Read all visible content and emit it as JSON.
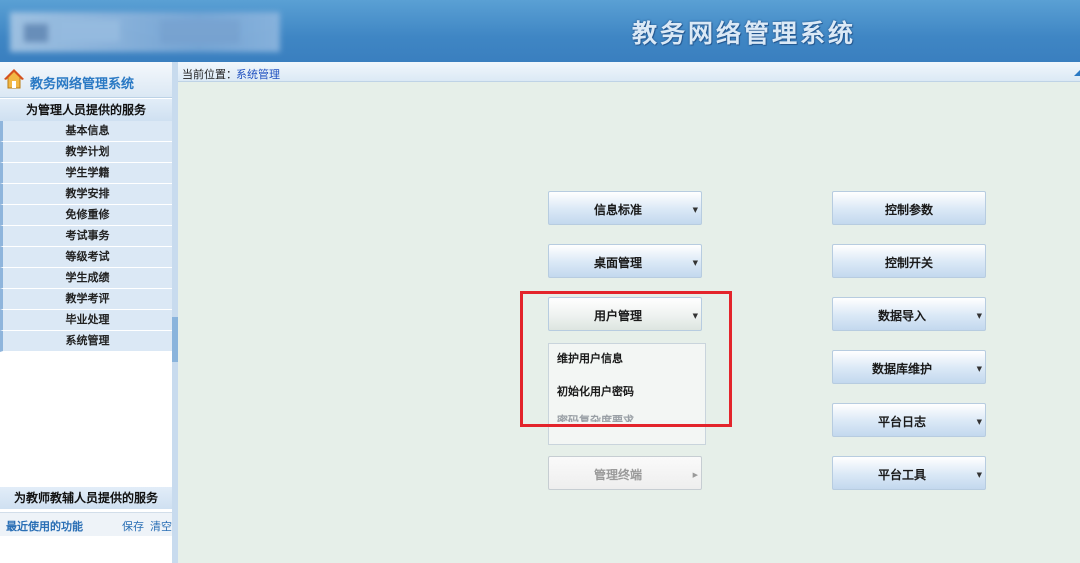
{
  "header": {
    "title": "教务网络管理系统"
  },
  "sidebar": {
    "brand": "教务网络管理系统",
    "admin_section": "为管理人员提供的服务",
    "items": [
      {
        "label": "基本信息"
      },
      {
        "label": "教学计划"
      },
      {
        "label": "学生学籍"
      },
      {
        "label": "教学安排"
      },
      {
        "label": "免修重修"
      },
      {
        "label": "考试事务"
      },
      {
        "label": "等级考试"
      },
      {
        "label": "学生成绩"
      },
      {
        "label": "教学考评"
      },
      {
        "label": "毕业处理"
      },
      {
        "label": "系统管理"
      }
    ],
    "teacher_section": "为教师教辅人员提供的服务",
    "recent": {
      "label": "最近使用的功能",
      "save": "保存",
      "clear": "清空"
    }
  },
  "breadcrumb": {
    "label": "当前位置：",
    "current": "系统管理"
  },
  "left_buttons": [
    {
      "label": "信息标准",
      "arrow": "▼"
    },
    {
      "label": "桌面管理",
      "arrow": "▼"
    },
    {
      "label": "用户管理",
      "arrow": "▼"
    },
    {
      "label": "管理终端",
      "arrow": "▶"
    }
  ],
  "user_menu": {
    "items": [
      "维护用户信息",
      "初始化用户密码",
      "密码复杂度要求"
    ]
  },
  "right_buttons": [
    {
      "label": "控制参数",
      "arrow": ""
    },
    {
      "label": "控制开关",
      "arrow": ""
    },
    {
      "label": "数据导入",
      "arrow": "▼"
    },
    {
      "label": "数据库维护",
      "arrow": "▼"
    },
    {
      "label": "平台日志",
      "arrow": "▼"
    },
    {
      "label": "平台工具",
      "arrow": "▼"
    }
  ],
  "colors": {
    "accent": "#2a79c4",
    "highlight": "#e3242b",
    "background": "#e6efe9"
  }
}
